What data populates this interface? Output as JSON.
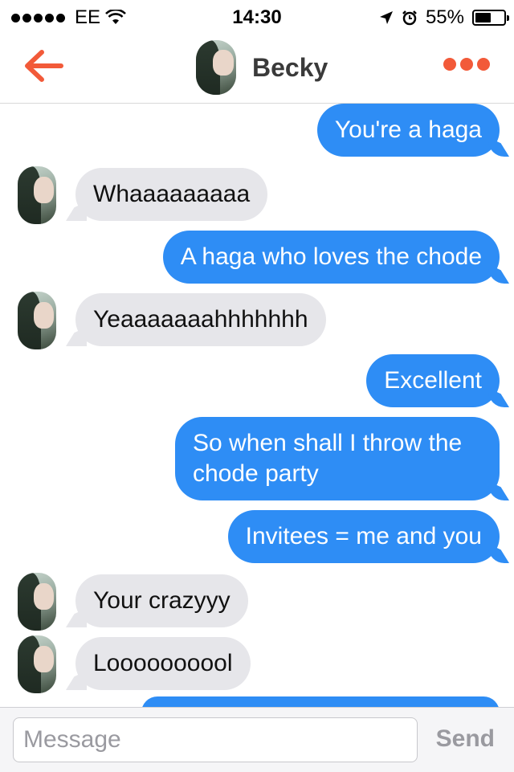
{
  "status_bar": {
    "carrier": "EE",
    "time": "14:30",
    "battery_percent": "55%",
    "battery_level": 0.55,
    "icons": [
      "signal-dots-icon",
      "wifi-icon",
      "location-arrow-icon",
      "alarm-icon",
      "battery-icon"
    ]
  },
  "header": {
    "contact_name": "Becky",
    "back_icon": "arrow-left-icon",
    "more_icon": "more-dots-icon",
    "accent_color": "#f25a39"
  },
  "messages": [
    {
      "side": "out",
      "text": "You're a haga"
    },
    {
      "side": "in",
      "text": "Whaaaaaaaaa"
    },
    {
      "side": "out",
      "text": "A haga who loves the chode"
    },
    {
      "side": "in",
      "text": "Yeaaaaaaahhhhhhh"
    },
    {
      "side": "out",
      "text": "Excellent"
    },
    {
      "side": "out",
      "text": "So when shall I throw the chode party"
    },
    {
      "side": "out",
      "text": "Invitees = me and you"
    },
    {
      "side": "in",
      "text": "Your crazyyy"
    },
    {
      "side": "in",
      "text": "Loooooooool"
    }
  ],
  "composer": {
    "placeholder": "Message",
    "value": "",
    "send_label": "Send"
  },
  "colors": {
    "outgoing_bubble": "#2e8df5",
    "incoming_bubble": "#e6e6ea"
  }
}
